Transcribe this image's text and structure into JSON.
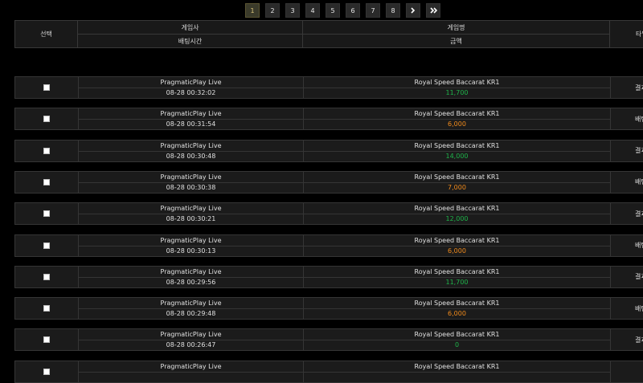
{
  "pagination": {
    "pages": [
      "1",
      "2",
      "3",
      "4",
      "5",
      "6",
      "7",
      "8"
    ],
    "active_page": "1",
    "next_icon": "chevron-right-icon",
    "last_icon": "double-chevron-right-icon"
  },
  "table": {
    "headers": {
      "select": "선택",
      "provider": "게임사",
      "bet_time": "배팅시간",
      "game_name": "게임명",
      "amount": "금액",
      "type": "타입"
    },
    "colors": {
      "win": "#1fb34a",
      "bet": "#f08a1c"
    },
    "rows": [
      {
        "provider": "PragmaticPlay Live",
        "time": "08-28 00:32:02",
        "game": "Royal Speed Baccarat KR1",
        "amount": "11,700",
        "status": "win",
        "type": "결과"
      },
      {
        "provider": "PragmaticPlay Live",
        "time": "08-28 00:31:54",
        "game": "Royal Speed Baccarat KR1",
        "amount": "6,000",
        "status": "bet",
        "type": "배팅"
      },
      {
        "provider": "PragmaticPlay Live",
        "time": "08-28 00:30:48",
        "game": "Royal Speed Baccarat KR1",
        "amount": "14,000",
        "status": "win",
        "type": "결과"
      },
      {
        "provider": "PragmaticPlay Live",
        "time": "08-28 00:30:38",
        "game": "Royal Speed Baccarat KR1",
        "amount": "7,000",
        "status": "bet",
        "type": "배팅"
      },
      {
        "provider": "PragmaticPlay Live",
        "time": "08-28 00:30:21",
        "game": "Royal Speed Baccarat KR1",
        "amount": "12,000",
        "status": "win",
        "type": "결과"
      },
      {
        "provider": "PragmaticPlay Live",
        "time": "08-28 00:30:13",
        "game": "Royal Speed Baccarat KR1",
        "amount": "6,000",
        "status": "bet",
        "type": "배팅"
      },
      {
        "provider": "PragmaticPlay Live",
        "time": "08-28 00:29:56",
        "game": "Royal Speed Baccarat KR1",
        "amount": "11,700",
        "status": "win",
        "type": "결과"
      },
      {
        "provider": "PragmaticPlay Live",
        "time": "08-28 00:29:48",
        "game": "Royal Speed Baccarat KR1",
        "amount": "6,000",
        "status": "bet",
        "type": "배팅"
      },
      {
        "provider": "PragmaticPlay Live",
        "time": "08-28 00:26:47",
        "game": "Royal Speed Baccarat KR1",
        "amount": "0",
        "status": "win",
        "type": "결과"
      },
      {
        "provider": "PragmaticPlay Live",
        "time": "",
        "game": "Royal Speed Baccarat KR1",
        "amount": "",
        "status": "bet",
        "type": ""
      }
    ]
  }
}
